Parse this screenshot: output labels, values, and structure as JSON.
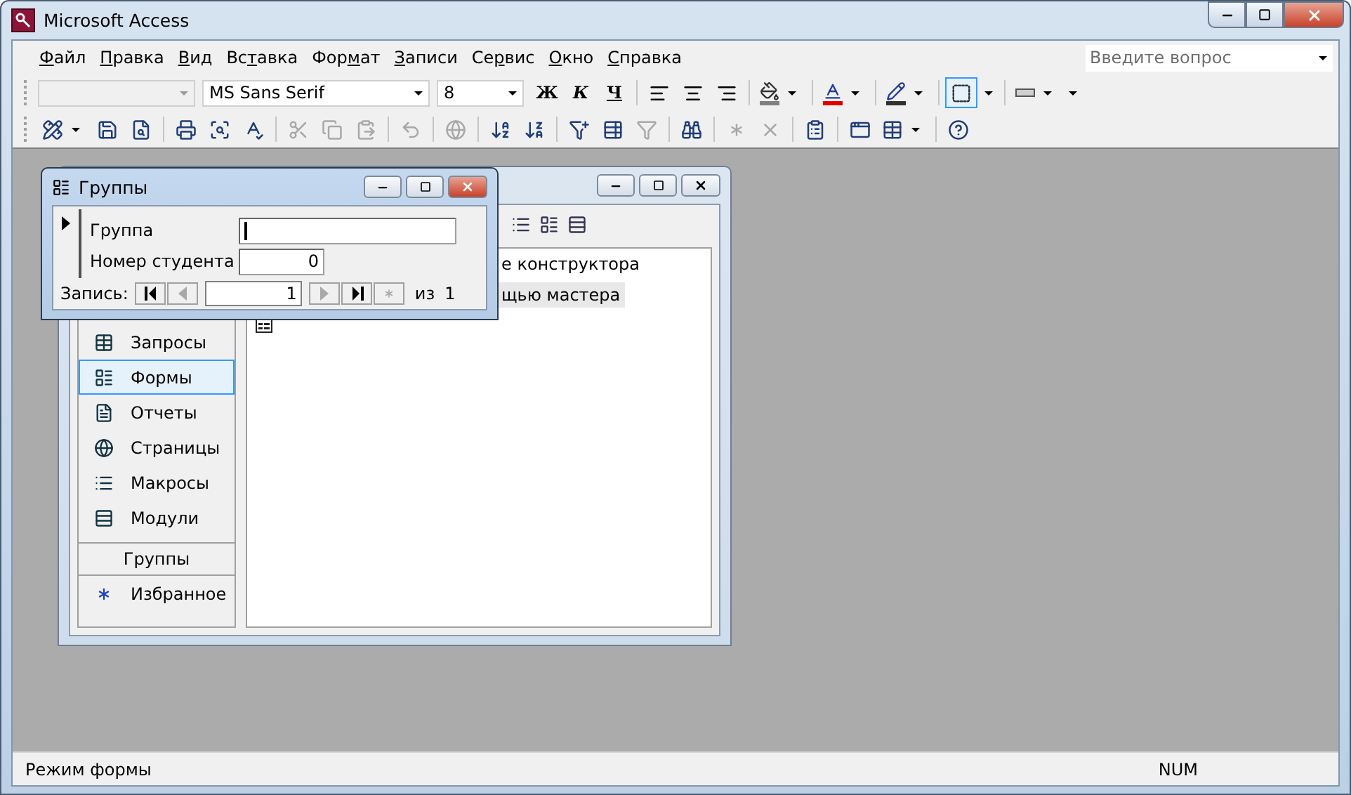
{
  "window": {
    "title": "Microsoft Access"
  },
  "menu": [
    {
      "accel": "Ф",
      "rest": "айл"
    },
    {
      "accel": "П",
      "rest": "равка"
    },
    {
      "accel": "В",
      "rest": "ид"
    },
    {
      "start": "Вс",
      "accel": "т",
      "rest": "авка"
    },
    {
      "start": "Фор",
      "accel": "м",
      "rest": "ат"
    },
    {
      "accel": "З",
      "rest": "аписи"
    },
    {
      "start": "Се",
      "accel": "р",
      "rest": "вис"
    },
    {
      "accel": "О",
      "rest": "кно"
    },
    {
      "accel": "С",
      "rest": "правка"
    }
  ],
  "help_box": {
    "placeholder": "Введите вопрос"
  },
  "format_toolbar": {
    "font": "MS Sans Serif",
    "size": "8",
    "styles": [
      "Ж",
      "К",
      "Ч"
    ],
    "border_selected": true
  },
  "standard_toolbar": [
    {
      "disabled": false
    },
    {
      "disabled": false
    },
    {
      "disabled": false
    },
    {
      "disabled": false
    },
    {
      "disabled": false
    },
    {
      "disabled": false
    },
    {
      "disabled": true
    },
    {
      "disabled": true
    },
    {
      "disabled": true
    },
    {
      "disabled": true
    },
    {
      "disabled": true
    },
    {
      "disabled": false
    },
    {
      "disabled": false
    },
    {
      "disabled": false
    },
    {
      "disabled": false
    },
    {
      "disabled": true
    },
    {
      "disabled": false
    },
    {
      "disabled": true
    },
    {
      "disabled": true
    },
    {
      "disabled": false
    },
    {
      "disabled": false
    },
    {
      "disabled": false
    },
    {
      "disabled": false
    }
  ],
  "database_window": {
    "sidebar": [
      {
        "label": "Запросы",
        "selected": false
      },
      {
        "label": "Формы",
        "selected": true
      },
      {
        "label": "Отчеты",
        "selected": false
      },
      {
        "label": "Страницы",
        "selected": false
      },
      {
        "label": "Макросы",
        "selected": false
      },
      {
        "label": "Модули",
        "selected": false
      }
    ],
    "groups": {
      "label": "Группы",
      "items": [
        {
          "label": "Избранное",
          "selected": false
        }
      ]
    },
    "objects": [
      {
        "label": "е конструктора",
        "selected": false
      },
      {
        "label": "щью мастера",
        "selected": true
      }
    ]
  },
  "form_window": {
    "title": "Группы",
    "fields": [
      {
        "label": "Группа",
        "focused": true
      },
      {
        "label": "Номер студента",
        "value": "0",
        "focused": false
      }
    ],
    "navigator": {
      "label": "Запись:",
      "current": "1",
      "of": "из",
      "total": "1",
      "first_disabled": false,
      "prev_disabled": true,
      "next_disabled": true,
      "last_disabled": false,
      "new_disabled": true
    }
  },
  "status_bar": {
    "text": "Режим формы",
    "indicator": "NUM"
  }
}
